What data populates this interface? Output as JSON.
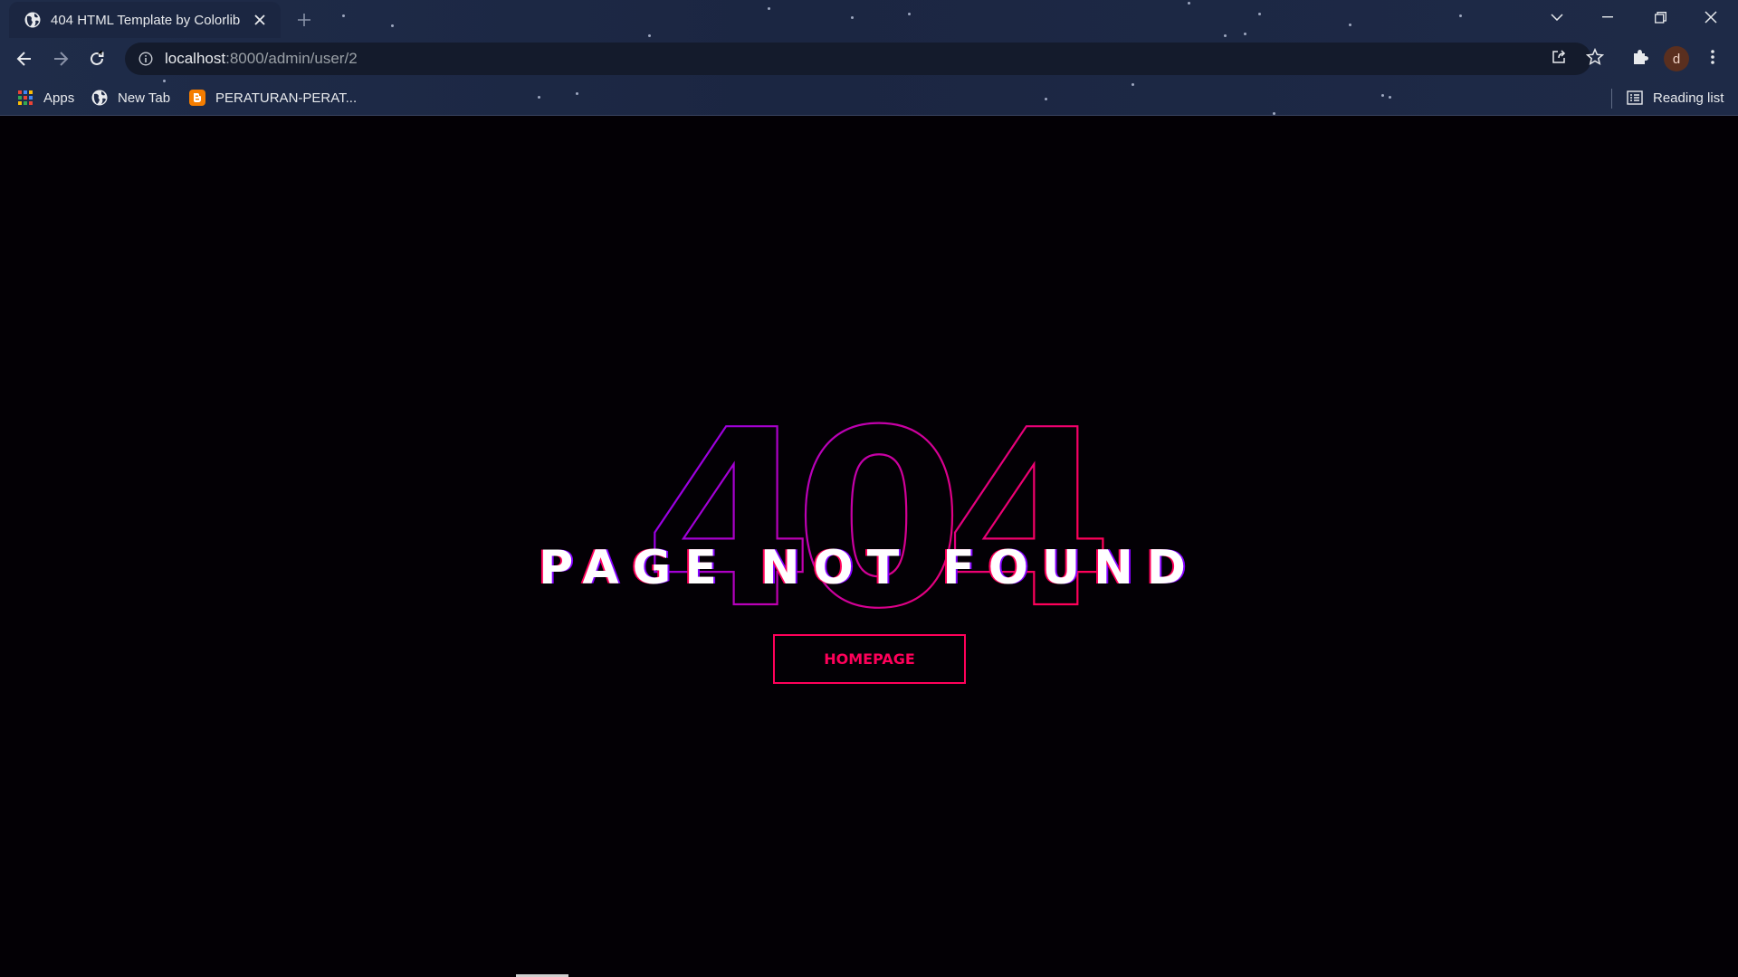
{
  "browser": {
    "tab_title": "404 HTML Template by Colorlib",
    "url_host": "localhost",
    "url_path": ":8000/admin/user/2",
    "profile_initial": "d",
    "bookmarks": [
      {
        "label": "Apps",
        "icon": "apps-grid-icon"
      },
      {
        "label": "New Tab",
        "icon": "globe-icon"
      },
      {
        "label": "PERATURAN-PERAT...",
        "icon": "blogger-icon"
      }
    ],
    "reading_list_label": "Reading list"
  },
  "page": {
    "error_code": "404",
    "headline": "PAGE NOT FOUND",
    "homepage_button": "HOMEPAGE"
  },
  "colors": {
    "accent_pink": "#ff005a",
    "accent_purple": "#8400ff",
    "background": "#030005"
  }
}
